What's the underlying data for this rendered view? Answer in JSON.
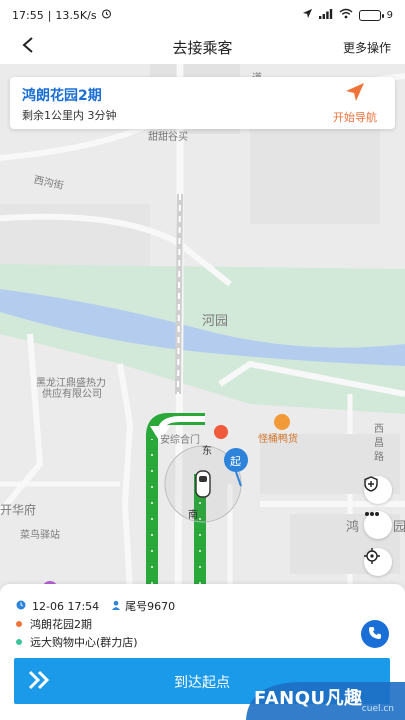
{
  "status": {
    "time": "17:55",
    "speed": "13.5K/s",
    "battery": "9"
  },
  "header": {
    "title": "去接乘客",
    "more_label": "更多操作"
  },
  "card": {
    "destination": "鸿朗花园2期",
    "remain": "剩余1公里内 3分钟",
    "nav_label": "开始导航"
  },
  "map": {
    "labels": {
      "street1": "西沟街",
      "top_shop": "甜甜谷买",
      "river": "河园",
      "company1": "黑龙江鼎盛热力",
      "company2": "供应有限公司",
      "market": "安综合门",
      "east": "东",
      "hotpot": "怪桶鸭货",
      "xiangchang": "西",
      "xiangchang2": "昌",
      "xiangchang3": "路",
      "kaihua": "开华府",
      "courier": "菜鸟驿站",
      "hong": "鸿",
      "park": "园",
      "road_m": "南",
      "start_marker": "起",
      "top_road": "道"
    }
  },
  "order": {
    "date": "12-06 17:54",
    "tail_label": "尾号9670",
    "pickup": "鸿朗花园2期",
    "dropoff": "远大购物中心(群力店)"
  },
  "action": {
    "arrive_label": "到达起点"
  },
  "watermark": {
    "brand": "FANQU凡趣",
    "sub": "cuel.cn"
  },
  "colors": {
    "accent_blue": "#1a6fd6",
    "button_blue": "#1a9ae8",
    "route_green": "#2aa83a",
    "nav_orange": "#f0733a",
    "pickup_orange": "#f0733a",
    "dropoff_green": "#3cc39a"
  },
  "icons": {
    "back": "back-chevron-icon",
    "navigate": "navigation-arrow-icon",
    "security": "shield-icon",
    "more": "ellipsis-icon",
    "locate": "locate-icon",
    "phone": "phone-icon",
    "clock": "clock-icon",
    "user": "user-icon"
  }
}
